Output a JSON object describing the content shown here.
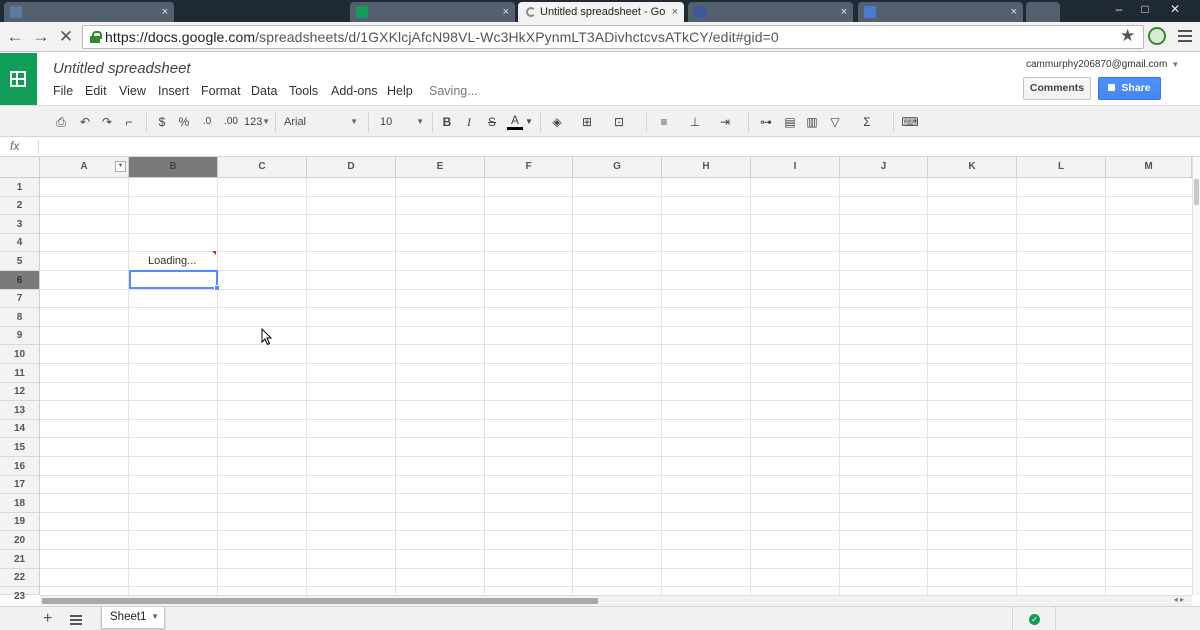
{
  "browser": {
    "tabs": [
      {
        "label": "",
        "favicon_color": "#5c7aa0",
        "active": false
      },
      {
        "label": "",
        "favicon_color": "#0f9d58",
        "active": false
      },
      {
        "label": "Untitled spreadsheet - Go",
        "favicon_color": "#0f9d58",
        "active": true
      },
      {
        "label": "",
        "favicon_color": "#3b5998",
        "active": false
      },
      {
        "label": "",
        "favicon_color": "#4a7bd0",
        "active": false
      }
    ],
    "url_host": "https://docs.google.com",
    "url_path": "/spreadsheets/d/1GXKlcjAfcN98VL-Wc3HkXPynmLT3ADivhctcvsATkCY/edit#gid=0",
    "tab_close_glyph": "×"
  },
  "app": {
    "title": "Untitled spreadsheet",
    "menu": [
      "File",
      "Edit",
      "View",
      "Insert",
      "Format",
      "Data",
      "Tools",
      "Add-ons",
      "Help"
    ],
    "status": "Saving...",
    "account": "cammurphy206870@gmail.com",
    "comments_label": "Comments",
    "share_label": "Share",
    "brand_color": "#0f9d58",
    "share_color": "#4d90fe"
  },
  "toolbar": {
    "currency": "$",
    "percent": "%",
    "decimal_less": ".0",
    "decimal_more": ".00",
    "more_formats": "123",
    "font": "Arial",
    "font_size": "10",
    "bold": "B",
    "italic": "I",
    "strike": "S",
    "text_color": "A",
    "sum": "Σ"
  },
  "formula_bar": {
    "label": "fx",
    "value": ""
  },
  "grid": {
    "columns": [
      "A",
      "B",
      "C",
      "D",
      "E",
      "F",
      "G",
      "H",
      "I",
      "J",
      "K",
      "L",
      "M"
    ],
    "rows": [
      "1",
      "2",
      "3",
      "4",
      "5",
      "6",
      "7",
      "8",
      "9",
      "10",
      "11",
      "12",
      "13",
      "14",
      "15",
      "16",
      "17",
      "18",
      "19",
      "20",
      "21",
      "22",
      "23"
    ],
    "selected_column": "B",
    "selected_row": "6",
    "cell_b5": "Loading..."
  },
  "sheets": {
    "add_label": "+",
    "tabs": [
      "Sheet1"
    ]
  }
}
